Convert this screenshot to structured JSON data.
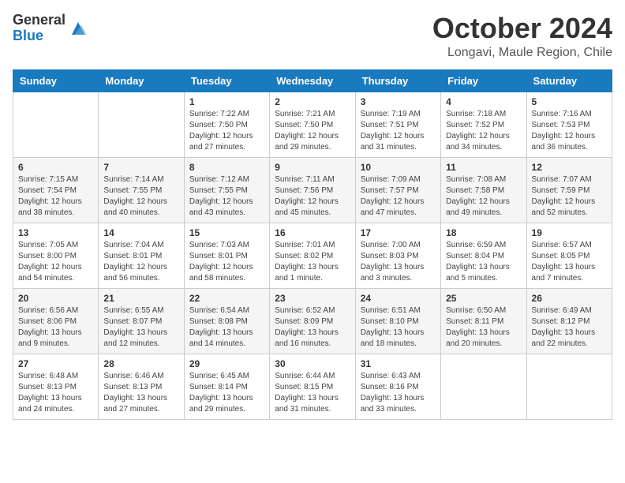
{
  "header": {
    "logo_general": "General",
    "logo_blue": "Blue",
    "month_title": "October 2024",
    "location": "Longavi, Maule Region, Chile"
  },
  "days_of_week": [
    "Sunday",
    "Monday",
    "Tuesday",
    "Wednesday",
    "Thursday",
    "Friday",
    "Saturday"
  ],
  "weeks": [
    [
      {
        "day": "",
        "info": ""
      },
      {
        "day": "",
        "info": ""
      },
      {
        "day": "1",
        "info": "Sunrise: 7:22 AM\nSunset: 7:50 PM\nDaylight: 12 hours\nand 27 minutes."
      },
      {
        "day": "2",
        "info": "Sunrise: 7:21 AM\nSunset: 7:50 PM\nDaylight: 12 hours\nand 29 minutes."
      },
      {
        "day": "3",
        "info": "Sunrise: 7:19 AM\nSunset: 7:51 PM\nDaylight: 12 hours\nand 31 minutes."
      },
      {
        "day": "4",
        "info": "Sunrise: 7:18 AM\nSunset: 7:52 PM\nDaylight: 12 hours\nand 34 minutes."
      },
      {
        "day": "5",
        "info": "Sunrise: 7:16 AM\nSunset: 7:53 PM\nDaylight: 12 hours\nand 36 minutes."
      }
    ],
    [
      {
        "day": "6",
        "info": "Sunrise: 7:15 AM\nSunset: 7:54 PM\nDaylight: 12 hours\nand 38 minutes."
      },
      {
        "day": "7",
        "info": "Sunrise: 7:14 AM\nSunset: 7:55 PM\nDaylight: 12 hours\nand 40 minutes."
      },
      {
        "day": "8",
        "info": "Sunrise: 7:12 AM\nSunset: 7:55 PM\nDaylight: 12 hours\nand 43 minutes."
      },
      {
        "day": "9",
        "info": "Sunrise: 7:11 AM\nSunset: 7:56 PM\nDaylight: 12 hours\nand 45 minutes."
      },
      {
        "day": "10",
        "info": "Sunrise: 7:09 AM\nSunset: 7:57 PM\nDaylight: 12 hours\nand 47 minutes."
      },
      {
        "day": "11",
        "info": "Sunrise: 7:08 AM\nSunset: 7:58 PM\nDaylight: 12 hours\nand 49 minutes."
      },
      {
        "day": "12",
        "info": "Sunrise: 7:07 AM\nSunset: 7:59 PM\nDaylight: 12 hours\nand 52 minutes."
      }
    ],
    [
      {
        "day": "13",
        "info": "Sunrise: 7:05 AM\nSunset: 8:00 PM\nDaylight: 12 hours\nand 54 minutes."
      },
      {
        "day": "14",
        "info": "Sunrise: 7:04 AM\nSunset: 8:01 PM\nDaylight: 12 hours\nand 56 minutes."
      },
      {
        "day": "15",
        "info": "Sunrise: 7:03 AM\nSunset: 8:01 PM\nDaylight: 12 hours\nand 58 minutes."
      },
      {
        "day": "16",
        "info": "Sunrise: 7:01 AM\nSunset: 8:02 PM\nDaylight: 13 hours\nand 1 minute."
      },
      {
        "day": "17",
        "info": "Sunrise: 7:00 AM\nSunset: 8:03 PM\nDaylight: 13 hours\nand 3 minutes."
      },
      {
        "day": "18",
        "info": "Sunrise: 6:59 AM\nSunset: 8:04 PM\nDaylight: 13 hours\nand 5 minutes."
      },
      {
        "day": "19",
        "info": "Sunrise: 6:57 AM\nSunset: 8:05 PM\nDaylight: 13 hours\nand 7 minutes."
      }
    ],
    [
      {
        "day": "20",
        "info": "Sunrise: 6:56 AM\nSunset: 8:06 PM\nDaylight: 13 hours\nand 9 minutes."
      },
      {
        "day": "21",
        "info": "Sunrise: 6:55 AM\nSunset: 8:07 PM\nDaylight: 13 hours\nand 12 minutes."
      },
      {
        "day": "22",
        "info": "Sunrise: 6:54 AM\nSunset: 8:08 PM\nDaylight: 13 hours\nand 14 minutes."
      },
      {
        "day": "23",
        "info": "Sunrise: 6:52 AM\nSunset: 8:09 PM\nDaylight: 13 hours\nand 16 minutes."
      },
      {
        "day": "24",
        "info": "Sunrise: 6:51 AM\nSunset: 8:10 PM\nDaylight: 13 hours\nand 18 minutes."
      },
      {
        "day": "25",
        "info": "Sunrise: 6:50 AM\nSunset: 8:11 PM\nDaylight: 13 hours\nand 20 minutes."
      },
      {
        "day": "26",
        "info": "Sunrise: 6:49 AM\nSunset: 8:12 PM\nDaylight: 13 hours\nand 22 minutes."
      }
    ],
    [
      {
        "day": "27",
        "info": "Sunrise: 6:48 AM\nSunset: 8:13 PM\nDaylight: 13 hours\nand 24 minutes."
      },
      {
        "day": "28",
        "info": "Sunrise: 6:46 AM\nSunset: 8:13 PM\nDaylight: 13 hours\nand 27 minutes."
      },
      {
        "day": "29",
        "info": "Sunrise: 6:45 AM\nSunset: 8:14 PM\nDaylight: 13 hours\nand 29 minutes."
      },
      {
        "day": "30",
        "info": "Sunrise: 6:44 AM\nSunset: 8:15 PM\nDaylight: 13 hours\nand 31 minutes."
      },
      {
        "day": "31",
        "info": "Sunrise: 6:43 AM\nSunset: 8:16 PM\nDaylight: 13 hours\nand 33 minutes."
      },
      {
        "day": "",
        "info": ""
      },
      {
        "day": "",
        "info": ""
      }
    ]
  ]
}
